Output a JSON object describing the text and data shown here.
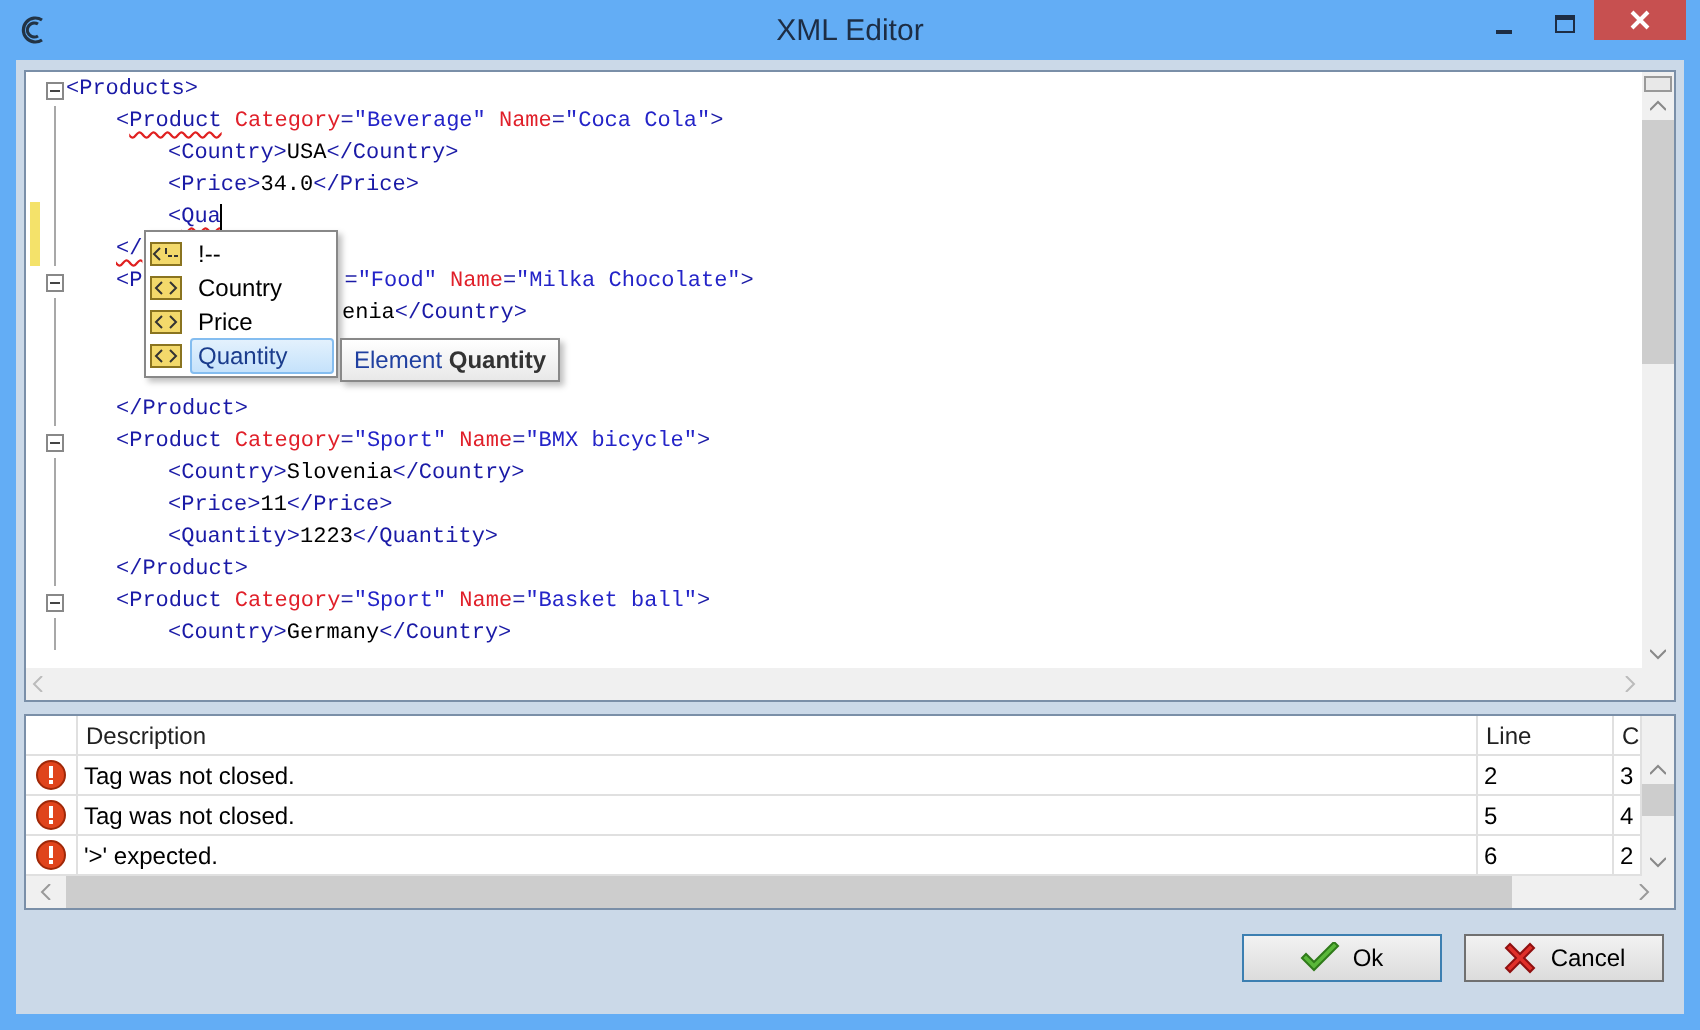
{
  "window": {
    "title": "XML Editor"
  },
  "editor": {
    "lines": [
      {
        "fold": true,
        "tokens": [
          {
            "kind": "tag",
            "text": "<Products>"
          }
        ],
        "children": [
          {
            "tokens": [
              {
                "kind": "tag",
                "text": "<"
              },
              {
                "kind": "tag",
                "text": "Product",
                "error": true
              },
              {
                "kind": "attr",
                "text": " Category"
              },
              {
                "kind": "tag",
                "text": "="
              },
              {
                "kind": "value",
                "text": "\"Beverage\""
              },
              {
                "kind": "attr",
                "text": " Name"
              },
              {
                "kind": "tag",
                "text": "="
              },
              {
                "kind": "value",
                "text": "\"Coca Cola\""
              },
              {
                "kind": "tag",
                "text": ">"
              }
            ],
            "children": [
              {
                "tokens": [
                  {
                    "kind": "tag",
                    "text": "<Country>"
                  },
                  {
                    "kind": "text",
                    "text": "USA"
                  },
                  {
                    "kind": "tag",
                    "text": "</Country>"
                  }
                ]
              },
              {
                "tokens": [
                  {
                    "kind": "tag",
                    "text": "<Price>"
                  },
                  {
                    "kind": "text",
                    "text": "34.0"
                  },
                  {
                    "kind": "tag",
                    "text": "</Price>"
                  }
                ]
              },
              {
                "changed": true,
                "caret": true,
                "tokens": [
                  {
                    "kind": "tag",
                    "text": "<"
                  },
                  {
                    "kind": "tag",
                    "text": "Qua",
                    "error": true
                  }
                ]
              }
            ]
          },
          {
            "changed": true,
            "tokens": [
              {
                "kind": "tag",
                "text": "</",
                "error": true
              }
            ]
          },
          {
            "fold": true,
            "tokens": [
              {
                "kind": "tag",
                "text": "<P"
              },
              {
                "kind": "gap"
              },
              {
                "kind": "tag",
                "text": "="
              },
              {
                "kind": "value",
                "text": "\"Food\""
              },
              {
                "kind": "attr",
                "text": " Name"
              },
              {
                "kind": "tag",
                "text": "="
              },
              {
                "kind": "value",
                "text": "\"Milka Chocolate\""
              },
              {
                "kind": "tag",
                "text": ">"
              }
            ],
            "children": [
              {
                "tokens": [
                  {
                    "kind": "gap"
                  },
                  {
                    "kind": "text",
                    "text": "enia"
                  },
                  {
                    "kind": "tag",
                    "text": "</Country>"
                  }
                ]
              }
            ]
          },
          {
            "blank": true
          },
          {
            "blank": true
          },
          {
            "tokens": [
              {
                "kind": "tag",
                "text": "</Product>"
              }
            ]
          },
          {
            "fold": true,
            "tokens": [
              {
                "kind": "tag",
                "text": "<Product"
              },
              {
                "kind": "attr",
                "text": " Category"
              },
              {
                "kind": "tag",
                "text": "="
              },
              {
                "kind": "value",
                "text": "\"Sport\""
              },
              {
                "kind": "attr",
                "text": " Name"
              },
              {
                "kind": "tag",
                "text": "="
              },
              {
                "kind": "value",
                "text": "\"BMX bicycle\""
              },
              {
                "kind": "tag",
                "text": ">"
              }
            ],
            "children": [
              {
                "tokens": [
                  {
                    "kind": "tag",
                    "text": "<Country>"
                  },
                  {
                    "kind": "text",
                    "text": "Slovenia"
                  },
                  {
                    "kind": "tag",
                    "text": "</Country>"
                  }
                ]
              },
              {
                "tokens": [
                  {
                    "kind": "tag",
                    "text": "<Price>"
                  },
                  {
                    "kind": "text",
                    "text": "11"
                  },
                  {
                    "kind": "tag",
                    "text": "</Price>"
                  }
                ]
              },
              {
                "tokens": [
                  {
                    "kind": "tag",
                    "text": "<Quantity>"
                  },
                  {
                    "kind": "text",
                    "text": "1223"
                  },
                  {
                    "kind": "tag",
                    "text": "</Quantity>"
                  }
                ]
              }
            ]
          },
          {
            "tokens": [
              {
                "kind": "tag",
                "text": "</Product>"
              }
            ]
          },
          {
            "fold": true,
            "tokens": [
              {
                "kind": "tag",
                "text": "<Product"
              },
              {
                "kind": "attr",
                "text": " Category"
              },
              {
                "kind": "tag",
                "text": "="
              },
              {
                "kind": "value",
                "text": "\"Sport\""
              },
              {
                "kind": "attr",
                "text": " Name"
              },
              {
                "kind": "tag",
                "text": "="
              },
              {
                "kind": "value",
                "text": "\"Basket ball\""
              },
              {
                "kind": "tag",
                "text": ">"
              }
            ],
            "children": [
              {
                "tokens": [
                  {
                    "kind": "tag",
                    "text": "<Country>"
                  },
                  {
                    "kind": "text",
                    "text": "Germany"
                  },
                  {
                    "kind": "tag",
                    "text": "</Country>"
                  }
                ]
              }
            ]
          }
        ]
      }
    ],
    "autocomplete": [
      {
        "kind": "comment",
        "label": "!--",
        "selected": false
      },
      {
        "kind": "element",
        "label": "Country",
        "selected": false
      },
      {
        "kind": "element",
        "label": "Price",
        "selected": false
      },
      {
        "kind": "element",
        "label": "Quantity",
        "selected": true
      }
    ],
    "tooltip": "Element **Quantity**"
  },
  "errors": {
    "columns": [
      "Description",
      "Line",
      "C"
    ],
    "rows": [
      {
        "description": "Tag was not closed.",
        "line": "2",
        "column_3": "3"
      },
      {
        "description": "Tag was not closed.",
        "line": "5",
        "column_3": "4"
      },
      {
        "description": "'>' expected.",
        "line": "6",
        "column_3": "2"
      }
    ]
  },
  "buttons": [
    {
      "kind": "ok",
      "label": "Ok"
    },
    {
      "kind": "cancel",
      "label": "Cancel"
    }
  ]
}
